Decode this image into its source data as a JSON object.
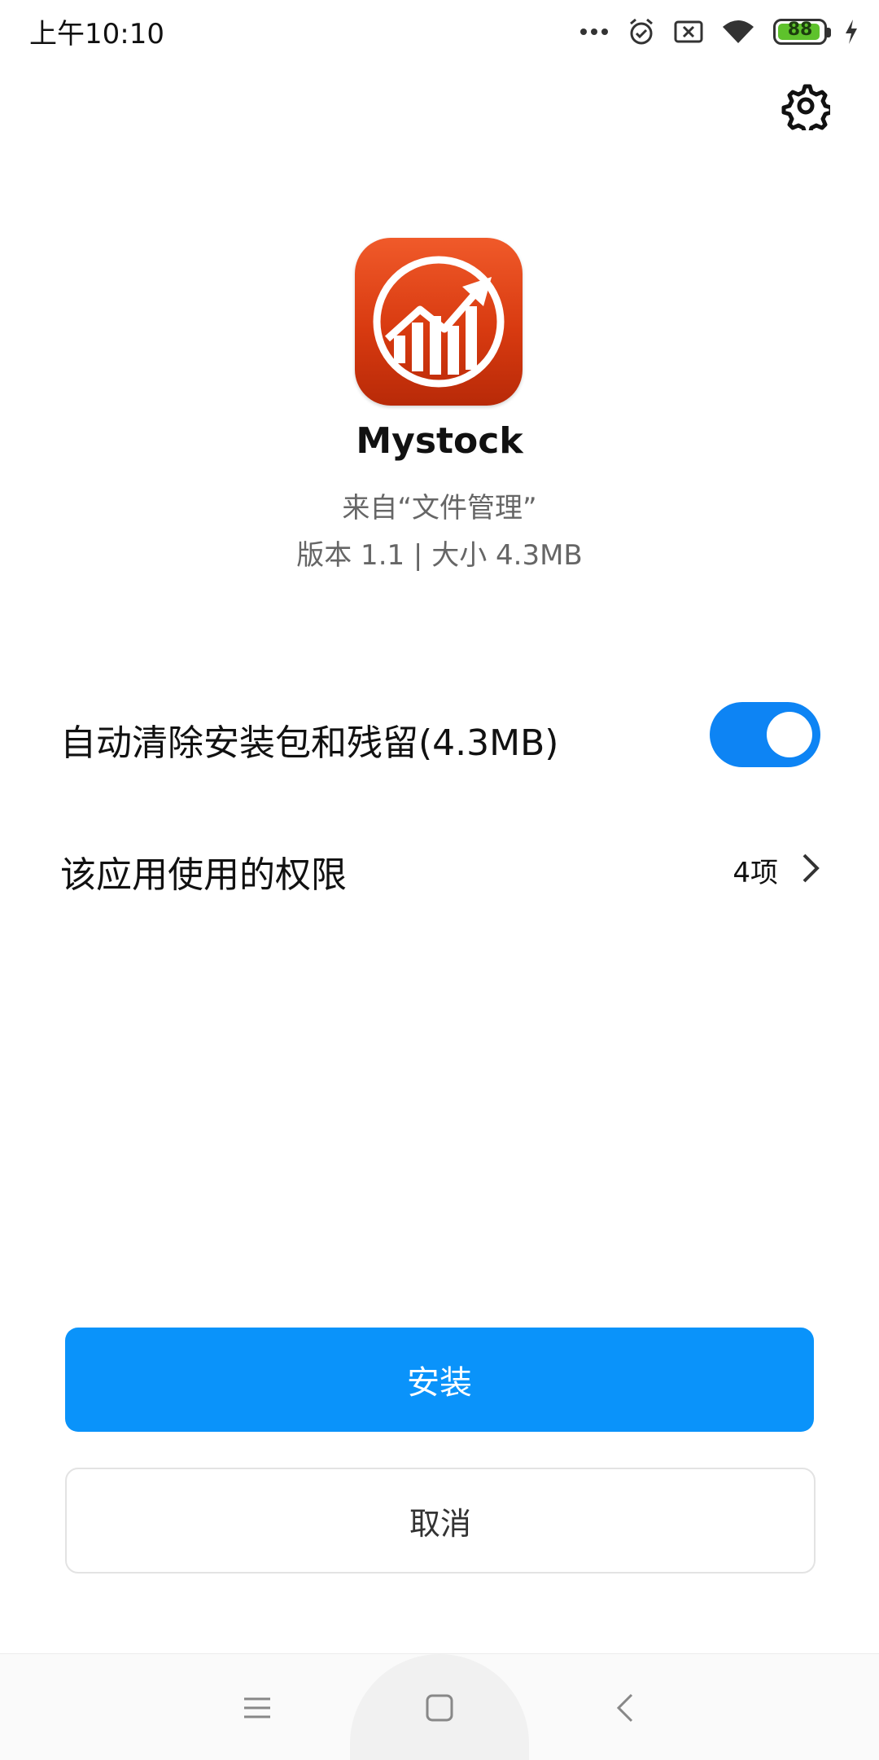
{
  "status_bar": {
    "time": "上午10:10",
    "battery_level": "88",
    "icons": [
      "more-dots-icon",
      "alarm-icon",
      "sim-off-icon",
      "wifi-icon",
      "battery-icon",
      "charging-icon"
    ]
  },
  "header": {
    "settings_icon": "gear-icon"
  },
  "app": {
    "name": "Mystock",
    "source": "来自“文件管理”",
    "meta": "版本 1.1 | 大小 4.3MB",
    "icon": "stock-chart-icon",
    "icon_color": "#e0451a"
  },
  "settings": {
    "auto_clean_label": "自动清除安装包和残留(4.3MB)",
    "auto_clean_enabled": true,
    "permissions_label": "该应用使用的权限",
    "permissions_count": "4项"
  },
  "actions": {
    "install_label": "安装",
    "cancel_label": "取消"
  },
  "nav_bar": {
    "icons": [
      "menu-icon",
      "home-icon",
      "back-icon"
    ]
  },
  "colors": {
    "accent": "#0a93fa",
    "toggle_on": "#0d84f4"
  }
}
